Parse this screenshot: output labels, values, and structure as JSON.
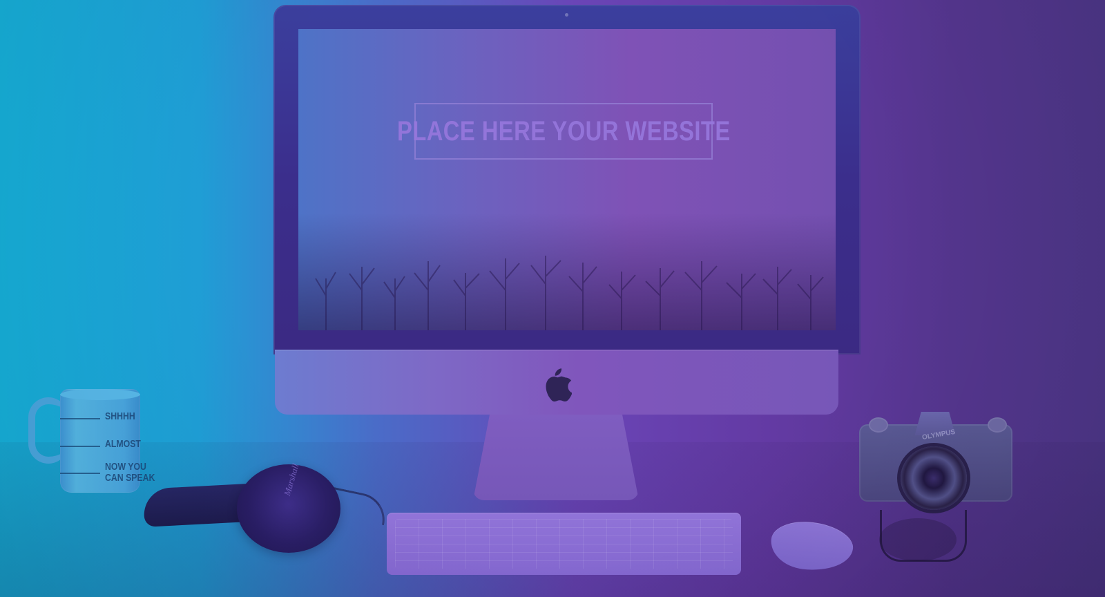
{
  "scene": {
    "gradient_colors": [
      "#16b0da",
      "#6a45b7",
      "#4d3688"
    ]
  },
  "monitor": {
    "screen_text": "PLACE HERE YOUR WEBSITE",
    "logo_icon": "apple-icon"
  },
  "mug": {
    "line_1": "SHHHH",
    "line_2": "ALMOST",
    "line_3_line_1": "NOW YOU",
    "line_3_line_2": "CAN SPEAK"
  },
  "headphones": {
    "brand_text": "Marshall"
  },
  "camera": {
    "brand_text": "OLYMPUS"
  }
}
